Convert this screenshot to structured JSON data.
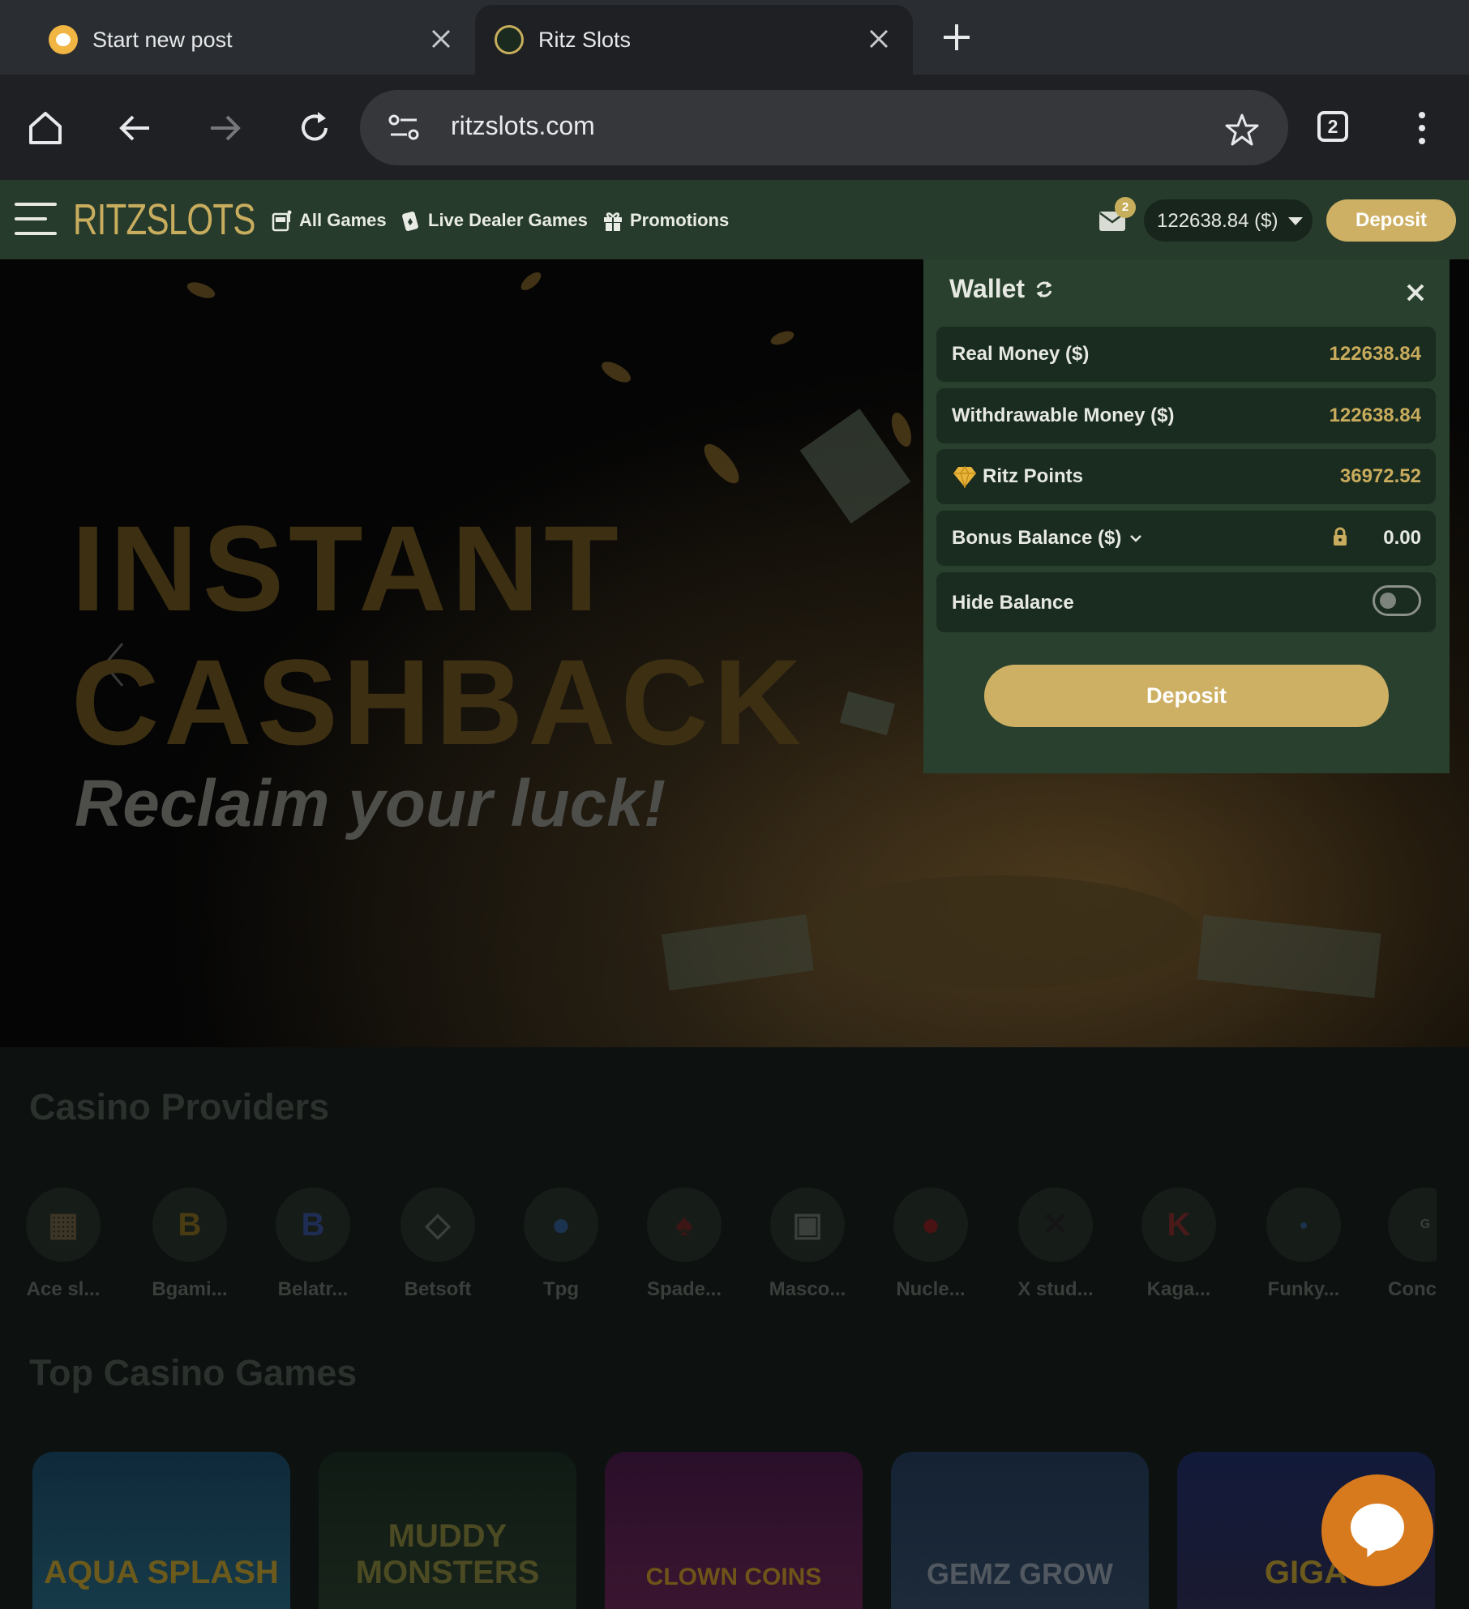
{
  "browser": {
    "tabs": [
      {
        "title": "Start new post"
      },
      {
        "title": "Ritz Slots"
      }
    ],
    "url": "ritzslots.com",
    "tab_count": "2"
  },
  "site": {
    "logo_text": "RITZSLOTS",
    "nav": [
      "All Games",
      "Live Dealer Games",
      "Promotions"
    ],
    "mail_badge": "2",
    "balance": "122638.84 ($)",
    "deposit_label": "Deposit"
  },
  "hero": {
    "line1": "INSTANT",
    "line2": "CASHBACK",
    "tagline": "Reclaim your luck!"
  },
  "wallet": {
    "title": "Wallet",
    "rows": [
      {
        "label": "Real Money ($)",
        "value": "122638.84"
      },
      {
        "label": "Withdrawable Money ($)",
        "value": "122638.84"
      },
      {
        "label": "Ritz Points",
        "value": "36972.52"
      },
      {
        "label": "Bonus Balance ($)",
        "value": "0.00"
      },
      {
        "label": "Hide Balance"
      }
    ],
    "hide_balance_on": false,
    "deposit_label": "Deposit"
  },
  "providers": {
    "title": "Casino Providers",
    "items": [
      "Ace sl...",
      "Bgami...",
      "Belatr...",
      "Betsoft",
      "Tpg",
      "Spade...",
      "Masco...",
      "Nucle...",
      "X stud...",
      "Kaga...",
      "Funky...",
      "Conc"
    ]
  },
  "games": {
    "title": "Top Casino Games",
    "items": [
      "AQUA SPLASH",
      "MUDDY MONSTERS",
      "CLOWN COINS",
      "GEMZ GROW",
      "GIGA"
    ]
  },
  "colors": {
    "nav_bg": "#263b2b",
    "wallet_bg": "#28402d",
    "gold": "#cdb064",
    "chat": "#d77a1d"
  }
}
